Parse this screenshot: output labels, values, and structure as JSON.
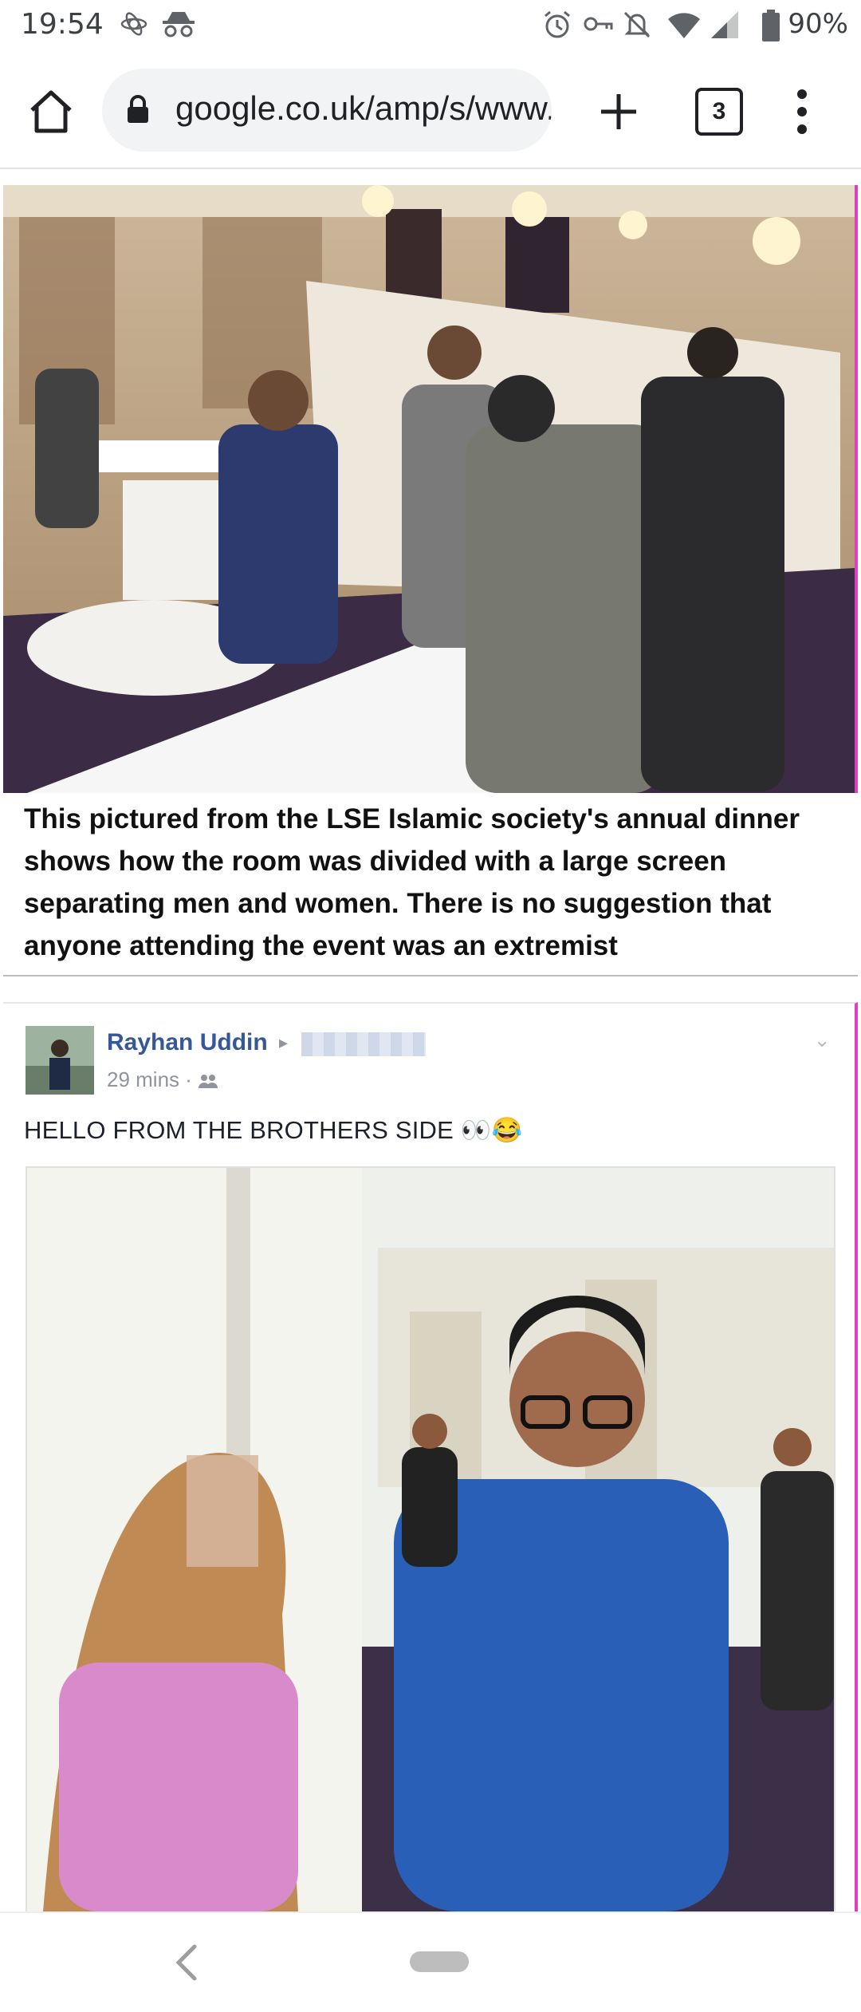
{
  "status_bar": {
    "time": "19:54",
    "battery": "90%",
    "icons": [
      "android-debug-icon",
      "incognito-icon",
      "alarm-icon",
      "vpn-key-icon",
      "notifications-off-icon",
      "wifi-icon",
      "signal-icon",
      "battery-icon"
    ]
  },
  "toolbar": {
    "url": "google.co.uk/amp/s/www.dailymail.co.uk",
    "tab_count": "3",
    "icons": [
      "home-icon",
      "lock-icon",
      "plus-icon",
      "tabs-icon",
      "more-vert-icon"
    ]
  },
  "article": {
    "caption": "This pictured from the LSE Islamic society's annual dinner shows how the room was divided with a large screen separating men and women. There is no suggestion that anyone attending the event was an extremist"
  },
  "fb_post": {
    "author": "Rayhan Uddin",
    "time": "29 mins · ",
    "text": "HELLO FROM THE BROTHERS SIDE 👀😂"
  },
  "nav": {
    "icons": [
      "back-icon",
      "home-pill-icon"
    ]
  }
}
